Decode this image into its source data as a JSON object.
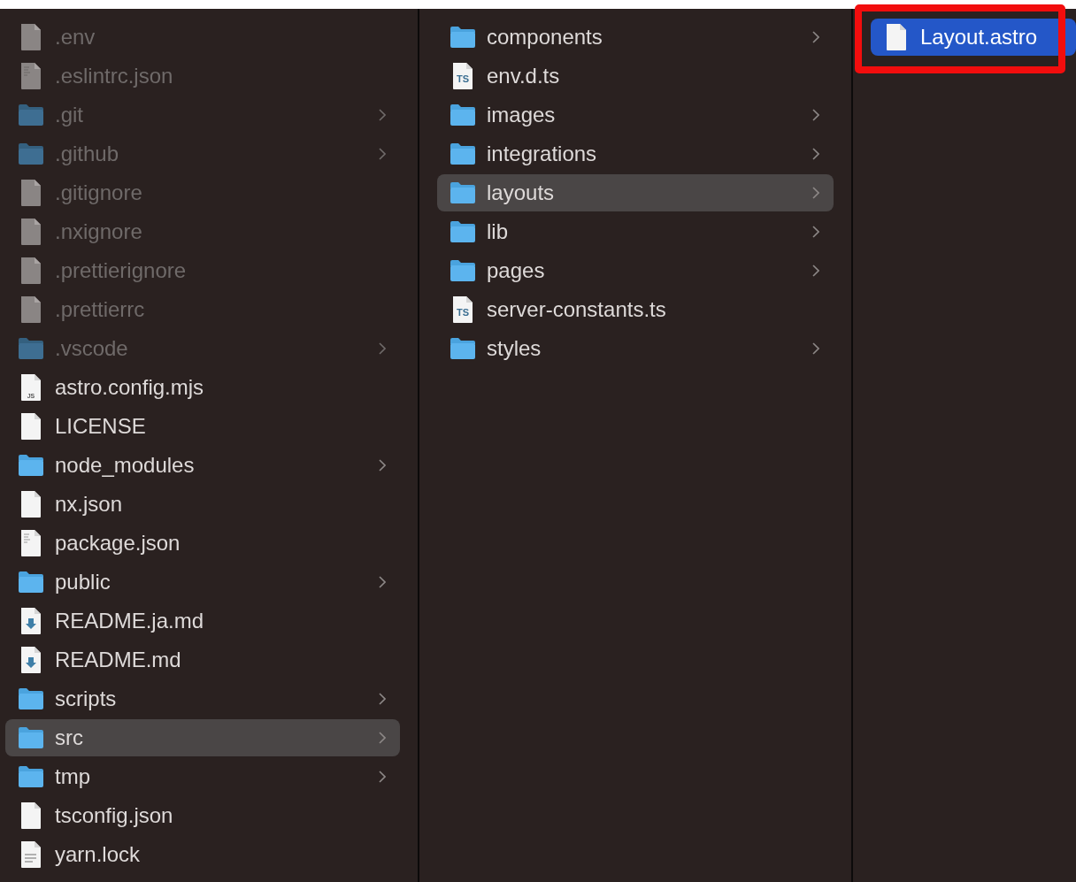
{
  "columns": [
    {
      "active": false,
      "items": [
        {
          "name": ".env",
          "kind": "file",
          "hidden": true,
          "selected": false
        },
        {
          "name": ".eslintrc.json",
          "kind": "doc",
          "hidden": true,
          "selected": false
        },
        {
          "name": ".git",
          "kind": "folder",
          "hidden": true,
          "selected": false
        },
        {
          "name": ".github",
          "kind": "folder",
          "hidden": true,
          "selected": false
        },
        {
          "name": ".gitignore",
          "kind": "file",
          "hidden": true,
          "selected": false
        },
        {
          "name": ".nxignore",
          "kind": "file",
          "hidden": true,
          "selected": false
        },
        {
          "name": ".prettierignore",
          "kind": "file",
          "hidden": true,
          "selected": false
        },
        {
          "name": ".prettierrc",
          "kind": "file",
          "hidden": true,
          "selected": false
        },
        {
          "name": ".vscode",
          "kind": "folder",
          "hidden": true,
          "selected": false
        },
        {
          "name": "astro.config.mjs",
          "kind": "badge",
          "badge": "JS",
          "hidden": false,
          "selected": false
        },
        {
          "name": "LICENSE",
          "kind": "file",
          "hidden": false,
          "selected": false
        },
        {
          "name": "node_modules",
          "kind": "folder",
          "hidden": false,
          "selected": false
        },
        {
          "name": "nx.json",
          "kind": "file",
          "hidden": false,
          "selected": false
        },
        {
          "name": "package.json",
          "kind": "doc",
          "hidden": false,
          "selected": false
        },
        {
          "name": "public",
          "kind": "folder",
          "hidden": false,
          "selected": false
        },
        {
          "name": "README.ja.md",
          "kind": "markdown",
          "hidden": false,
          "selected": false
        },
        {
          "name": "README.md",
          "kind": "markdown",
          "hidden": false,
          "selected": false
        },
        {
          "name": "scripts",
          "kind": "folder",
          "hidden": false,
          "selected": false
        },
        {
          "name": "src",
          "kind": "folder",
          "hidden": false,
          "selected": true
        },
        {
          "name": "tmp",
          "kind": "folder",
          "hidden": false,
          "selected": false
        },
        {
          "name": "tsconfig.json",
          "kind": "file",
          "hidden": false,
          "selected": false
        },
        {
          "name": "yarn.lock",
          "kind": "text",
          "hidden": false,
          "selected": false
        }
      ]
    },
    {
      "active": false,
      "items": [
        {
          "name": "components",
          "kind": "folder",
          "hidden": false,
          "selected": false
        },
        {
          "name": "env.d.ts",
          "kind": "badge",
          "badge": "TS",
          "hidden": false,
          "selected": false
        },
        {
          "name": "images",
          "kind": "folder",
          "hidden": false,
          "selected": false
        },
        {
          "name": "integrations",
          "kind": "folder",
          "hidden": false,
          "selected": false
        },
        {
          "name": "layouts",
          "kind": "folder",
          "hidden": false,
          "selected": true
        },
        {
          "name": "lib",
          "kind": "folder",
          "hidden": false,
          "selected": false
        },
        {
          "name": "pages",
          "kind": "folder",
          "hidden": false,
          "selected": false
        },
        {
          "name": "server-constants.ts",
          "kind": "badge",
          "badge": "TS",
          "hidden": false,
          "selected": false
        },
        {
          "name": "styles",
          "kind": "folder",
          "hidden": false,
          "selected": false
        }
      ]
    },
    {
      "active": true,
      "items": [
        {
          "name": "Layout.astro",
          "kind": "file",
          "hidden": false,
          "selected": true,
          "circled": true
        }
      ]
    }
  ]
}
